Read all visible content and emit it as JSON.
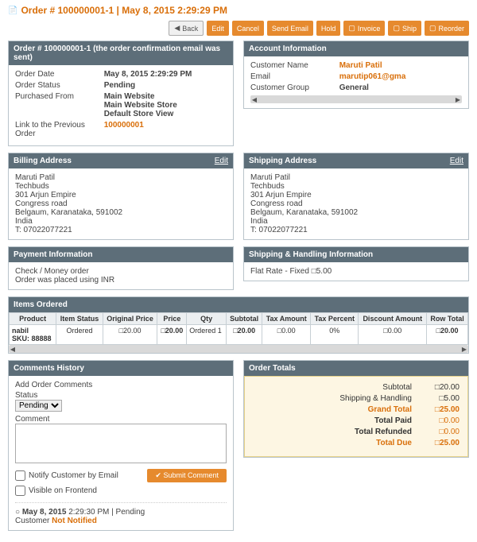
{
  "header": {
    "title": "Order # 100000001-1 | May 8, 2015 2:29:29 PM",
    "buttons": {
      "back": "Back",
      "edit": "Edit",
      "cancel": "Cancel",
      "send_email": "Send Email",
      "hold": "Hold",
      "invoice": "Invoice",
      "ship": "Ship",
      "reorder": "Reorder"
    }
  },
  "order_info": {
    "head": "Order # 100000001-1 (the order confirmation email was sent)",
    "date_label": "Order Date",
    "date_value": "May 8, 2015 2:29:29 PM",
    "status_label": "Order Status",
    "status_value": "Pending",
    "from_label": "Purchased From",
    "from_value": "Main Website\nMain Website Store\nDefault Store View",
    "prev_label": "Link to the Previous Order",
    "prev_value": "100000001"
  },
  "account": {
    "head": "Account Information",
    "name_label": "Customer Name",
    "name_value": "Maruti Patil",
    "email_label": "Email",
    "email_value": "marutip061@gma",
    "group_label": "Customer Group",
    "group_value": "General"
  },
  "billing": {
    "head": "Billing Address",
    "edit": "Edit",
    "text": "Maruti Patil\nTechbuds\n301 Arjun Empire\nCongress road\nBelgaum, Karanataka, 591002\nIndia\nT: 07022077221"
  },
  "shipping": {
    "head": "Shipping Address",
    "edit": "Edit",
    "text": "Maruti Patil\nTechbuds\n301 Arjun Empire\nCongress road\nBelgaum, Karanataka, 591002\nIndia\nT: 07022077221"
  },
  "payment": {
    "head": "Payment Information",
    "text": "Check / Money order\nOrder was placed using INR"
  },
  "shipmethod": {
    "head": "Shipping & Handling Information",
    "text": "Flat Rate - Fixed □5.00"
  },
  "items": {
    "head": "Items Ordered",
    "cols": [
      "Product",
      "Item Status",
      "Original Price",
      "Price",
      "Qty",
      "Subtotal",
      "Tax Amount",
      "Tax Percent",
      "Discount Amount",
      "Row Total"
    ],
    "rows": [
      {
        "product": "nabil\nSKU: 88888",
        "status": "Ordered",
        "oprice": "□20.00",
        "price": "□20.00",
        "qty": "Ordered 1",
        "subtotal": "□20.00",
        "taxamt": "□0.00",
        "taxpct": "0%",
        "discount": "□0.00",
        "rowtotal": "□20.00"
      }
    ]
  },
  "comments": {
    "head": "Comments History",
    "add_label": "Add Order Comments",
    "status_label": "Status",
    "status_option": "Pending",
    "comment_label": "Comment",
    "notify_label": "Notify Customer by Email",
    "visible_label": "Visible on Frontend",
    "submit": "Submit Comment",
    "history_date": "May 8, 2015",
    "history_time": "2:29:30 PM",
    "history_status": "Pending",
    "history_customer": "Customer",
    "history_notified": "Not Notified"
  },
  "totals": {
    "head": "Order Totals",
    "rows": {
      "subtotal_l": "Subtotal",
      "subtotal_v": "□20.00",
      "ship_l": "Shipping & Handling",
      "ship_v": "□5.00",
      "grand_l": "Grand Total",
      "grand_v": "□25.00",
      "paid_l": "Total Paid",
      "paid_v": "□0.00",
      "refund_l": "Total Refunded",
      "refund_v": "□0.00",
      "due_l": "Total Due",
      "due_v": "□25.00"
    }
  }
}
